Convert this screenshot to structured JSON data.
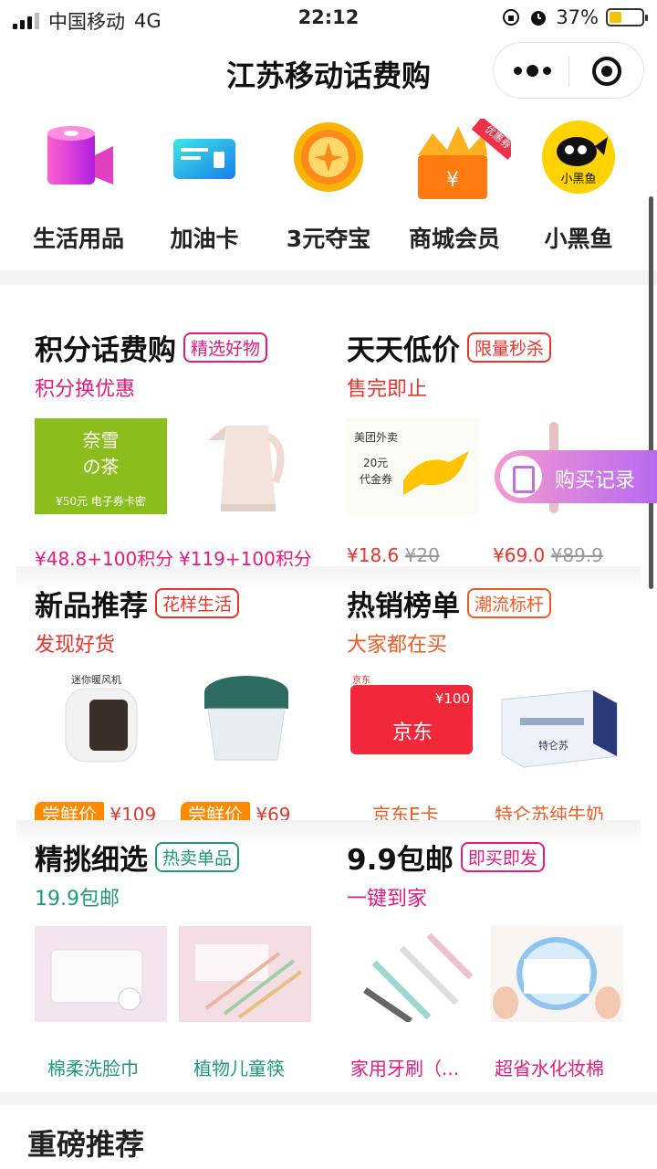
{
  "status": {
    "carrier": "中国移动",
    "network": "4G",
    "time": "22:12",
    "battery": "37%",
    "battery_level": 0.37
  },
  "nav": {
    "title": "江苏移动话费购"
  },
  "quick": [
    {
      "label": "生活用品",
      "icon": "tissue-roll-icon"
    },
    {
      "label": "加油卡",
      "icon": "fuel-card-icon"
    },
    {
      "label": "3元夺宝",
      "icon": "treasure-coin-icon"
    },
    {
      "label": "商城会员",
      "icon": "crown-coupon-icon",
      "badge": "优惠券"
    },
    {
      "label": "小黑鱼",
      "icon": "black-fish-icon",
      "logo_text": "小黑鱼"
    }
  ],
  "sections": [
    {
      "title": "积分话费购",
      "tag": "精选好物",
      "sub": "积分换优惠",
      "color": "#e6197f",
      "products": [
        {
          "image_text": [
            "奈雪",
            "の茶",
            "¥50元 电子券卡密"
          ],
          "price": "¥48.8+100积分"
        },
        {
          "price": "¥119+100积分"
        }
      ]
    },
    {
      "title": "天天低价",
      "tag": "限量秒杀",
      "sub": "售完即止",
      "color": "#e8342a",
      "products": [
        {
          "image_text": [
            "美团外卖",
            "20元",
            "代金券"
          ],
          "price": "¥18.6",
          "old_price": "¥20"
        },
        {
          "price": "¥69.0",
          "old_price": "¥89.9"
        }
      ]
    },
    {
      "title": "新品推荐",
      "tag": "花样生活",
      "sub": "发现好货",
      "color": "#e8342a",
      "products": [
        {
          "image_text": [
            "迷你暖风机"
          ],
          "badge": "尝鲜价",
          "price": "¥109"
        },
        {
          "badge": "尝鲜价",
          "price": "¥69"
        }
      ]
    },
    {
      "title": "热销榜单",
      "tag": "潮流标杆",
      "sub": "大家都在买",
      "color": "#f05a22",
      "products": [
        {
          "image_text": [
            "京东",
            "¥100",
            "京东"
          ],
          "name": "京东E卡"
        },
        {
          "image_text": [
            "特仑苏"
          ],
          "name": "特仑苏纯牛奶"
        }
      ]
    },
    {
      "title": "精挑细选",
      "tag": "热卖单品",
      "sub": "19.9包邮",
      "color": "#1e9a7a",
      "products": [
        {
          "name": "棉柔洗脸巾"
        },
        {
          "name": "植物儿童筷"
        }
      ]
    },
    {
      "title": "9.9包邮",
      "tag": "即买即发",
      "sub": "一键到家",
      "color": "#e6197f",
      "products": [
        {
          "name": "家用牙刷（..."
        },
        {
          "name": "超省水化妆棉"
        }
      ]
    }
  ],
  "float": {
    "label": "购买记录"
  },
  "bottom": {
    "title": "重磅推荐"
  }
}
